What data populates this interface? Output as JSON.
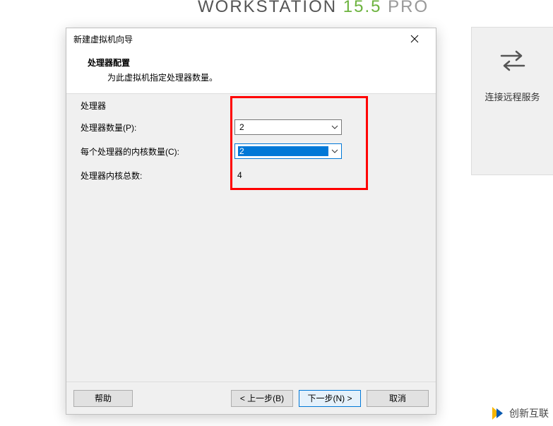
{
  "brand": {
    "word1": "WORKSTATION",
    "version": "15.5",
    "edition": "PRO"
  },
  "side": {
    "label": "连接远程服务"
  },
  "dialog": {
    "title": "新建虚拟机向导",
    "header_title": "处理器配置",
    "header_subtitle": "为此虚拟机指定处理器数量。",
    "group_label": "处理器",
    "row_processors_label": "处理器数量(P):",
    "row_cores_label": "每个处理器的内核数量(C):",
    "row_total_label": "处理器内核总数:",
    "processors_value": "2",
    "cores_value": "2",
    "total_value": "4",
    "help_btn": "帮助",
    "back_btn": "< 上一步(B)",
    "next_btn": "下一步(N) >",
    "cancel_btn": "取消"
  },
  "watermark": "创新互联"
}
